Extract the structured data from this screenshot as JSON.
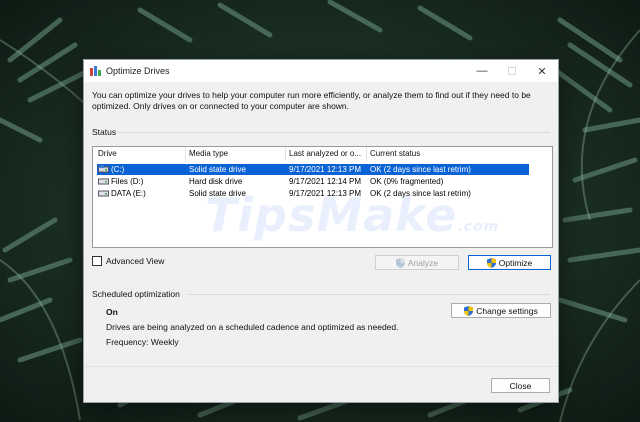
{
  "window": {
    "title": "Optimize Drives",
    "controls": {
      "minimize": "—",
      "maximize": "☐",
      "close": "✕"
    }
  },
  "description": "You can optimize your drives to help your computer run more efficiently, or analyze them to find out if they need to be optimized. Only drives on or connected to your computer are shown.",
  "status": {
    "label": "Status",
    "columns": [
      "Drive",
      "Media type",
      "Last analyzed or o...",
      "Current status"
    ],
    "rows": [
      {
        "drive": "(C:)",
        "media": "Solid state drive",
        "last": "9/17/2021 12:13 PM",
        "status": "OK (2 days since last retrim)",
        "selected": true
      },
      {
        "drive": "Files (D:)",
        "media": "Hard disk drive",
        "last": "9/17/2021 12:14 PM",
        "status": "OK (0% fragmented)",
        "selected": false
      },
      {
        "drive": "DATA (E:)",
        "media": "Solid state drive",
        "last": "9/17/2021 12:13 PM",
        "status": "OK (2 days since last retrim)",
        "selected": false
      }
    ]
  },
  "advanced_view": {
    "label": "Advanced View",
    "checked": false
  },
  "buttons": {
    "analyze": "Analyze",
    "optimize": "Optimize",
    "change_settings": "Change settings",
    "close": "Close"
  },
  "scheduled": {
    "label": "Scheduled optimization",
    "state": "On",
    "description": "Drives are being analyzed on a scheduled cadence and optimized as needed.",
    "frequency": "Frequency: Weekly"
  },
  "watermark": {
    "main": "TipsMake",
    "suffix": ".com"
  },
  "colors": {
    "selection": "#0a63d5",
    "dialog": "#f0f0f0",
    "accent": "#0a63d5"
  }
}
